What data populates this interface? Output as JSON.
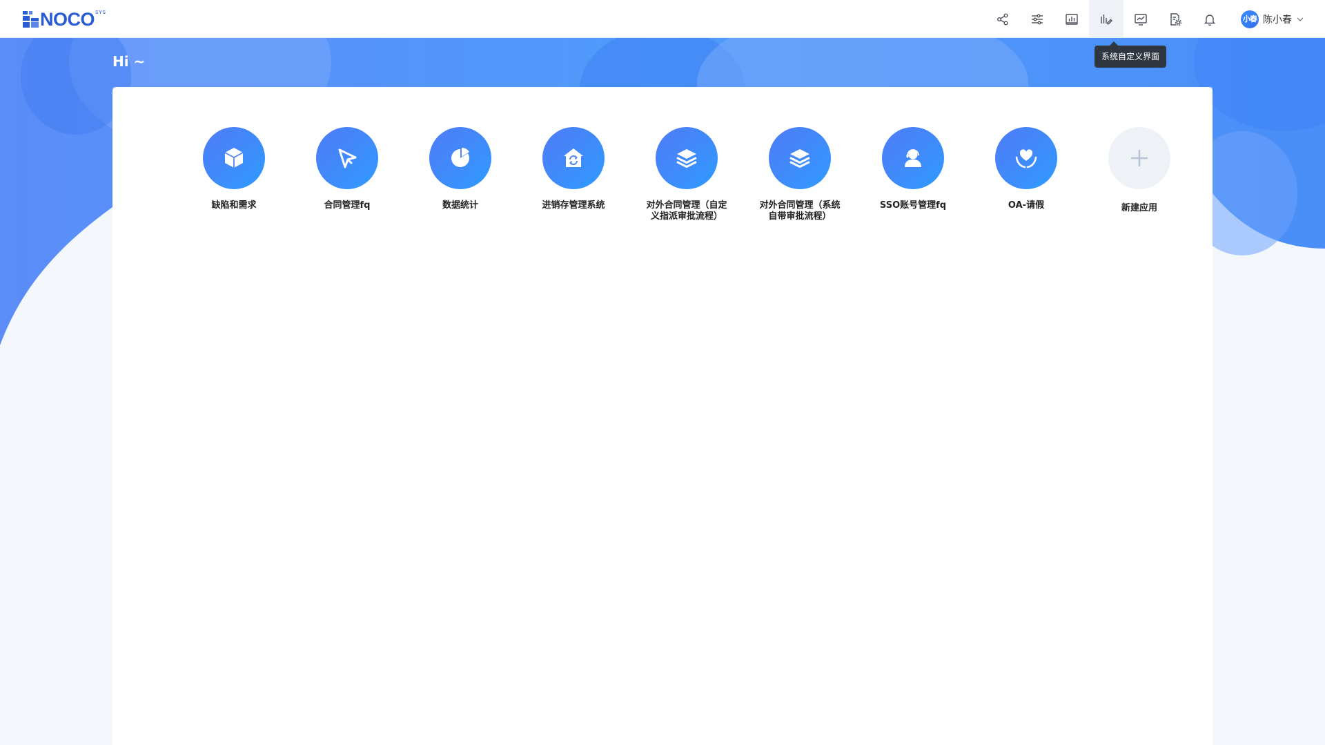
{
  "header": {
    "logo_text": "NOCO",
    "logo_sup": "SYS",
    "tools": [
      {
        "icon": "share-icon",
        "label": "share"
      },
      {
        "icon": "sliders-icon",
        "label": "settings"
      },
      {
        "icon": "bar-chart-icon",
        "label": "report"
      },
      {
        "icon": "chart-edit-icon",
        "label": "custom-ui"
      },
      {
        "icon": "monitor-chart-icon",
        "label": "dashboard"
      },
      {
        "icon": "file-settings-icon",
        "label": "file-settings"
      },
      {
        "icon": "bell-icon",
        "label": "notifications"
      }
    ],
    "active_tool_tooltip": "系统自定义界面",
    "user": {
      "avatar_text": "小春",
      "name": "陈小春"
    }
  },
  "main": {
    "greeting": "Hi ~",
    "apps": [
      {
        "label": "缺陷和需求",
        "icon": "cube-icon"
      },
      {
        "label": "合同管理fq",
        "icon": "send-arrow-icon"
      },
      {
        "label": "数据统计",
        "icon": "pie-chart-icon"
      },
      {
        "label": "进销存管理系统",
        "icon": "home-refresh-icon"
      },
      {
        "label": "对外合同管理（自定义指派审批流程）",
        "icon": "layers-icon"
      },
      {
        "label": "对外合同管理（系统自带审批流程）",
        "icon": "layers-icon"
      },
      {
        "label": "SSO账号管理fq",
        "icon": "support-agent-icon"
      },
      {
        "label": "OA-请假",
        "icon": "heart-hand-icon"
      }
    ],
    "new_app_label": "新建应用"
  },
  "colors": {
    "brand": "#2a5bd7",
    "accent": "#3d8dfb",
    "tooltip_bg": "#2f3640"
  }
}
